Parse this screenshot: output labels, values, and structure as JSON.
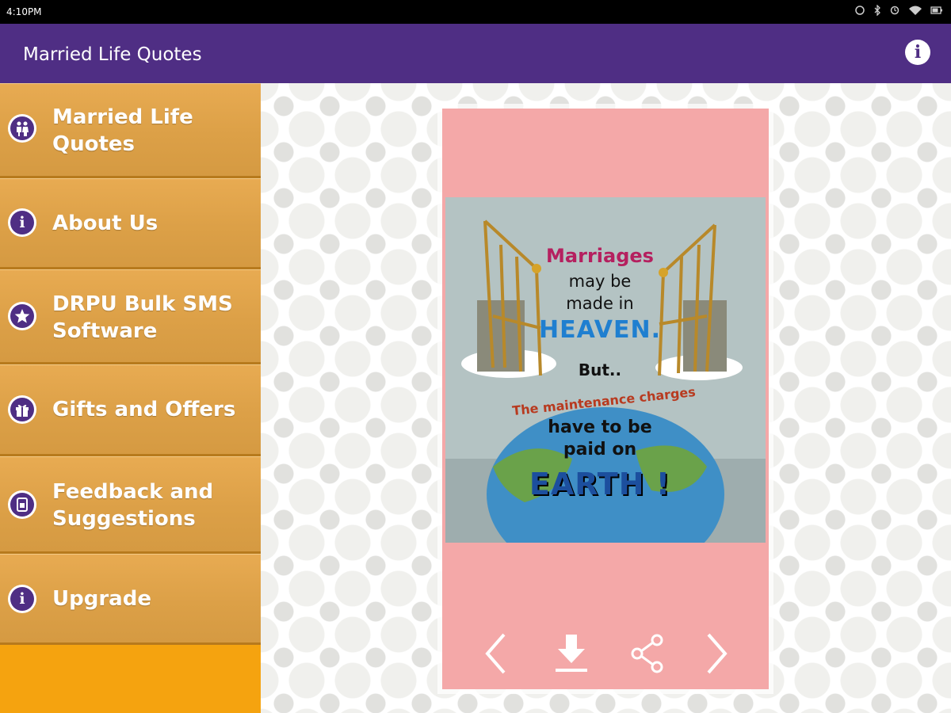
{
  "status": {
    "time": "4:10PM"
  },
  "app": {
    "title": "Married Life Quotes",
    "info_icon": "info-icon"
  },
  "drawer": {
    "items": [
      {
        "label": "Married Life\nQuotes",
        "icon": "couple-icon"
      },
      {
        "label": "About Us",
        "icon": "info-icon"
      },
      {
        "label": "DRPU Bulk SMS\nSoftware",
        "icon": "star-icon"
      },
      {
        "label": "Gifts and Offers",
        "icon": "gift-icon"
      },
      {
        "label": "Feedback and\nSuggestions",
        "icon": "feedback-icon"
      },
      {
        "label": "Upgrade",
        "icon": "info-icon"
      }
    ]
  },
  "quote": {
    "line1": "Marriages",
    "line2": "may be",
    "line3": "made in",
    "line4": "HEAVEN.",
    "line5": "But..",
    "line6": "The maintenance charges",
    "line7": "have to be",
    "line8": "paid on",
    "line9": "EARTH !"
  },
  "controls": [
    "previous-icon",
    "download-icon",
    "share-icon",
    "next-icon"
  ],
  "colors": {
    "primary": "#4f2e84",
    "drawer": "#dca047",
    "card": "#f4a8a8"
  }
}
